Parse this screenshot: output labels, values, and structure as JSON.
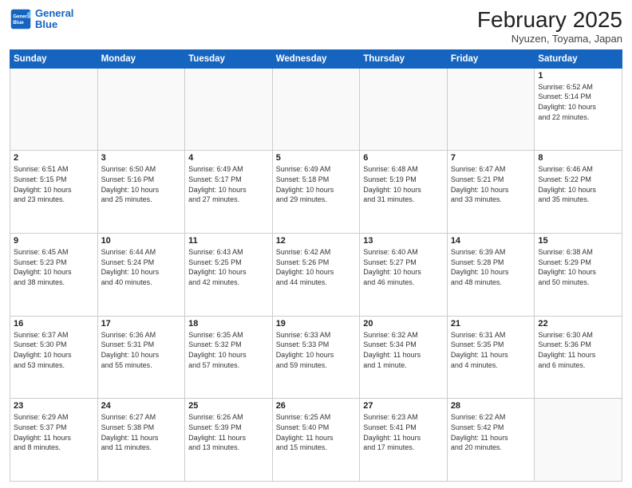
{
  "header": {
    "logo_line1": "General",
    "logo_line2": "Blue",
    "month_title": "February 2025",
    "location": "Nyuzen, Toyama, Japan"
  },
  "days_of_week": [
    "Sunday",
    "Monday",
    "Tuesday",
    "Wednesday",
    "Thursday",
    "Friday",
    "Saturday"
  ],
  "weeks": [
    [
      {
        "day": "",
        "info": ""
      },
      {
        "day": "",
        "info": ""
      },
      {
        "day": "",
        "info": ""
      },
      {
        "day": "",
        "info": ""
      },
      {
        "day": "",
        "info": ""
      },
      {
        "day": "",
        "info": ""
      },
      {
        "day": "1",
        "info": "Sunrise: 6:52 AM\nSunset: 5:14 PM\nDaylight: 10 hours\nand 22 minutes."
      }
    ],
    [
      {
        "day": "2",
        "info": "Sunrise: 6:51 AM\nSunset: 5:15 PM\nDaylight: 10 hours\nand 23 minutes."
      },
      {
        "day": "3",
        "info": "Sunrise: 6:50 AM\nSunset: 5:16 PM\nDaylight: 10 hours\nand 25 minutes."
      },
      {
        "day": "4",
        "info": "Sunrise: 6:49 AM\nSunset: 5:17 PM\nDaylight: 10 hours\nand 27 minutes."
      },
      {
        "day": "5",
        "info": "Sunrise: 6:49 AM\nSunset: 5:18 PM\nDaylight: 10 hours\nand 29 minutes."
      },
      {
        "day": "6",
        "info": "Sunrise: 6:48 AM\nSunset: 5:19 PM\nDaylight: 10 hours\nand 31 minutes."
      },
      {
        "day": "7",
        "info": "Sunrise: 6:47 AM\nSunset: 5:21 PM\nDaylight: 10 hours\nand 33 minutes."
      },
      {
        "day": "8",
        "info": "Sunrise: 6:46 AM\nSunset: 5:22 PM\nDaylight: 10 hours\nand 35 minutes."
      }
    ],
    [
      {
        "day": "9",
        "info": "Sunrise: 6:45 AM\nSunset: 5:23 PM\nDaylight: 10 hours\nand 38 minutes."
      },
      {
        "day": "10",
        "info": "Sunrise: 6:44 AM\nSunset: 5:24 PM\nDaylight: 10 hours\nand 40 minutes."
      },
      {
        "day": "11",
        "info": "Sunrise: 6:43 AM\nSunset: 5:25 PM\nDaylight: 10 hours\nand 42 minutes."
      },
      {
        "day": "12",
        "info": "Sunrise: 6:42 AM\nSunset: 5:26 PM\nDaylight: 10 hours\nand 44 minutes."
      },
      {
        "day": "13",
        "info": "Sunrise: 6:40 AM\nSunset: 5:27 PM\nDaylight: 10 hours\nand 46 minutes."
      },
      {
        "day": "14",
        "info": "Sunrise: 6:39 AM\nSunset: 5:28 PM\nDaylight: 10 hours\nand 48 minutes."
      },
      {
        "day": "15",
        "info": "Sunrise: 6:38 AM\nSunset: 5:29 PM\nDaylight: 10 hours\nand 50 minutes."
      }
    ],
    [
      {
        "day": "16",
        "info": "Sunrise: 6:37 AM\nSunset: 5:30 PM\nDaylight: 10 hours\nand 53 minutes."
      },
      {
        "day": "17",
        "info": "Sunrise: 6:36 AM\nSunset: 5:31 PM\nDaylight: 10 hours\nand 55 minutes."
      },
      {
        "day": "18",
        "info": "Sunrise: 6:35 AM\nSunset: 5:32 PM\nDaylight: 10 hours\nand 57 minutes."
      },
      {
        "day": "19",
        "info": "Sunrise: 6:33 AM\nSunset: 5:33 PM\nDaylight: 10 hours\nand 59 minutes."
      },
      {
        "day": "20",
        "info": "Sunrise: 6:32 AM\nSunset: 5:34 PM\nDaylight: 11 hours\nand 1 minute."
      },
      {
        "day": "21",
        "info": "Sunrise: 6:31 AM\nSunset: 5:35 PM\nDaylight: 11 hours\nand 4 minutes."
      },
      {
        "day": "22",
        "info": "Sunrise: 6:30 AM\nSunset: 5:36 PM\nDaylight: 11 hours\nand 6 minutes."
      }
    ],
    [
      {
        "day": "23",
        "info": "Sunrise: 6:29 AM\nSunset: 5:37 PM\nDaylight: 11 hours\nand 8 minutes."
      },
      {
        "day": "24",
        "info": "Sunrise: 6:27 AM\nSunset: 5:38 PM\nDaylight: 11 hours\nand 11 minutes."
      },
      {
        "day": "25",
        "info": "Sunrise: 6:26 AM\nSunset: 5:39 PM\nDaylight: 11 hours\nand 13 minutes."
      },
      {
        "day": "26",
        "info": "Sunrise: 6:25 AM\nSunset: 5:40 PM\nDaylight: 11 hours\nand 15 minutes."
      },
      {
        "day": "27",
        "info": "Sunrise: 6:23 AM\nSunset: 5:41 PM\nDaylight: 11 hours\nand 17 minutes."
      },
      {
        "day": "28",
        "info": "Sunrise: 6:22 AM\nSunset: 5:42 PM\nDaylight: 11 hours\nand 20 minutes."
      },
      {
        "day": "",
        "info": ""
      }
    ]
  ]
}
